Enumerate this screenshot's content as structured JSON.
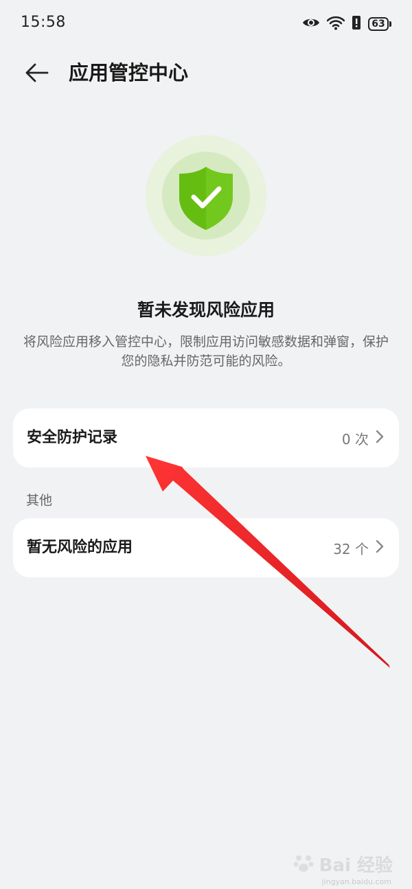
{
  "status_bar": {
    "time": "15:58",
    "battery": "63",
    "icons": [
      "eye-icon",
      "wifi-icon",
      "alert-icon",
      "battery-icon"
    ]
  },
  "header": {
    "title": "应用管控中心",
    "back_icon": "arrow-left-icon"
  },
  "empty_state": {
    "title": "暂未发现风险应用",
    "description": "将风险应用移入管控中心，限制应用访问敏感数据和弹窗，保护您的隐私并防范可能的风险。",
    "icon": "shield-check-icon"
  },
  "cards": [
    {
      "label": "安全防护记录",
      "value": "0 次"
    },
    {
      "label": "暂无风险的应用",
      "value": "32 个"
    }
  ],
  "section_other": {
    "label": "其他"
  },
  "watermark": {
    "text": "Bai 经验",
    "sub": "jingyan.baidu.com"
  },
  "colors": {
    "background": "#f1f2f4",
    "card": "#ffffff",
    "shield_green": "#72c81d",
    "annotation_red": "#e8151b"
  }
}
